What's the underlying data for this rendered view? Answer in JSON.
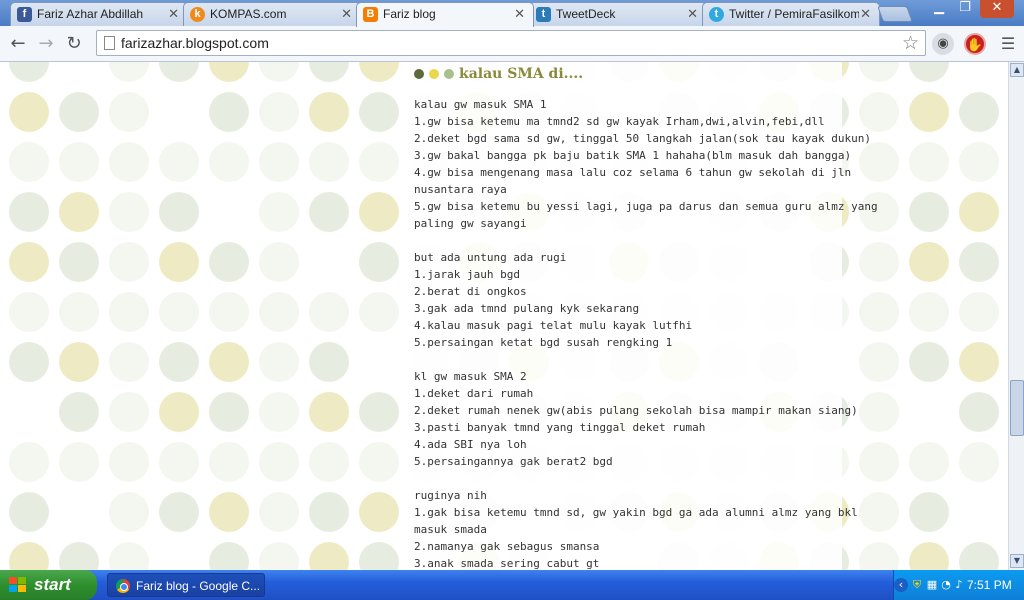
{
  "tabs": [
    {
      "label": "Fariz Azhar Abdillah",
      "icon": "facebook-icon",
      "color": "#3b5998",
      "glyph": "f"
    },
    {
      "label": "KOMPAS.com",
      "icon": "kompas-icon",
      "color": "#f08a1c",
      "glyph": "k"
    },
    {
      "label": "Fariz blog",
      "icon": "blogger-icon",
      "color": "#f57d00",
      "glyph": "B",
      "active": true
    },
    {
      "label": "TweetDeck",
      "icon": "tweetdeck-icon",
      "color": "#2b7bb9",
      "glyph": "t"
    },
    {
      "label": "Twitter / PemiraFasilkom",
      "icon": "twitter-icon",
      "color": "#2fa9e0",
      "glyph": "t"
    }
  ],
  "toolbar": {
    "url": "farizazhar.blogspot.com"
  },
  "post": {
    "title": "kalau SMA di....",
    "dot_colors": [
      "#5b6b3a",
      "#e8d84a",
      "#a8c08a"
    ],
    "lines": [
      "kalau gw masuk SMA 1",
      "1.gw bisa ketemu ma tmnd2 sd gw kayak Irham,dwi,alvin,febi,dll",
      "2.deket bgd sama sd gw, tinggal 50 langkah jalan(sok tau kayak dukun)",
      "3.gw bakal bangga pk baju batik SMA 1 hahaha(blm masuk dah bangga)",
      "4.gw bisa mengenang masa lalu coz selama 6 tahun gw sekolah di jln",
      "nusantara raya",
      "5.gw bisa ketemu bu yessi lagi, juga pa darus dan semua guru almz yang",
      "paling gw sayangi",
      "",
      "but ada untung ada rugi",
      "1.jarak jauh bgd",
      "2.berat di ongkos",
      "3.gak ada tmnd pulang kyk sekarang",
      "4.kalau masuk pagi telat mulu kayak lutfhi",
      "5.persaingan ketat bgd susah rengking 1",
      "",
      "kl gw masuk SMA 2",
      "1.deket dari rumah",
      "2.deket rumah nenek gw(abis pulang sekolah bisa mampir makan siang)",
      "3.pasti banyak tmnd yang tinggal deket rumah",
      "4.ada SBI nya loh",
      "5.persaingannya gak berat2 bgd",
      "",
      "ruginya nih",
      "1.gak bisa ketemu tmnd sd, gw yakin bgd ga ada alumni almz yang bkl",
      "masuk smada",
      "2.namanya gak sebagus smansa",
      "3.anak smada sering cabut gt"
    ]
  },
  "taskbar": {
    "start_label": "start",
    "task_label": "Fariz blog - Google C...",
    "clock": "7:51 PM"
  },
  "colors": {
    "dot_light": "#e6ede0",
    "dot_yellow": "#eeebc4",
    "dot_faint": "#f4f6f0"
  }
}
